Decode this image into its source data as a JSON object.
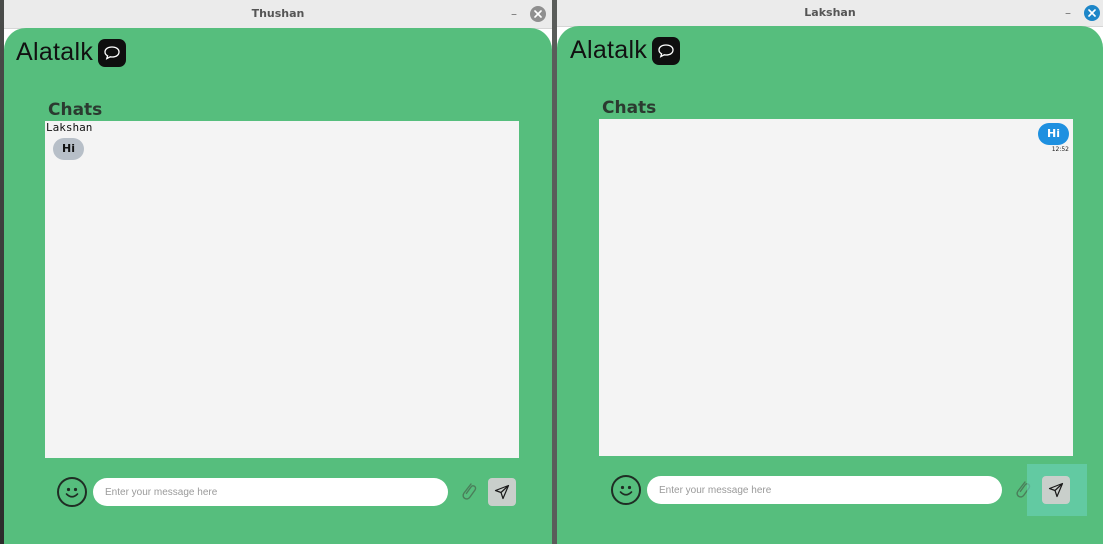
{
  "windows": [
    {
      "title": "Thushan",
      "app_name": "Alatalk",
      "chats_heading": "Chats",
      "sender_name": "Lakshan",
      "messages": [
        {
          "direction": "incoming",
          "text": "Hi"
        }
      ],
      "input_placeholder": "Enter your message here",
      "minimize_label": "–"
    },
    {
      "title": "Lakshan",
      "app_name": "Alatalk",
      "chats_heading": "Chats",
      "messages": [
        {
          "direction": "outgoing",
          "text": "Hi",
          "time": "12:52"
        }
      ],
      "input_placeholder": "Enter your message here",
      "minimize_label": "–"
    }
  ],
  "colors": {
    "app_background": "#56be7d",
    "chat_panel": "#f4f4f4",
    "outgoing_bubble": "#1e90e0",
    "incoming_bubble": "#b7bfc8",
    "close_active": "#1d86c8"
  },
  "icons": [
    "chat-bubble-icon",
    "smiley-icon",
    "paperclip-icon",
    "send-icon",
    "close-icon"
  ]
}
